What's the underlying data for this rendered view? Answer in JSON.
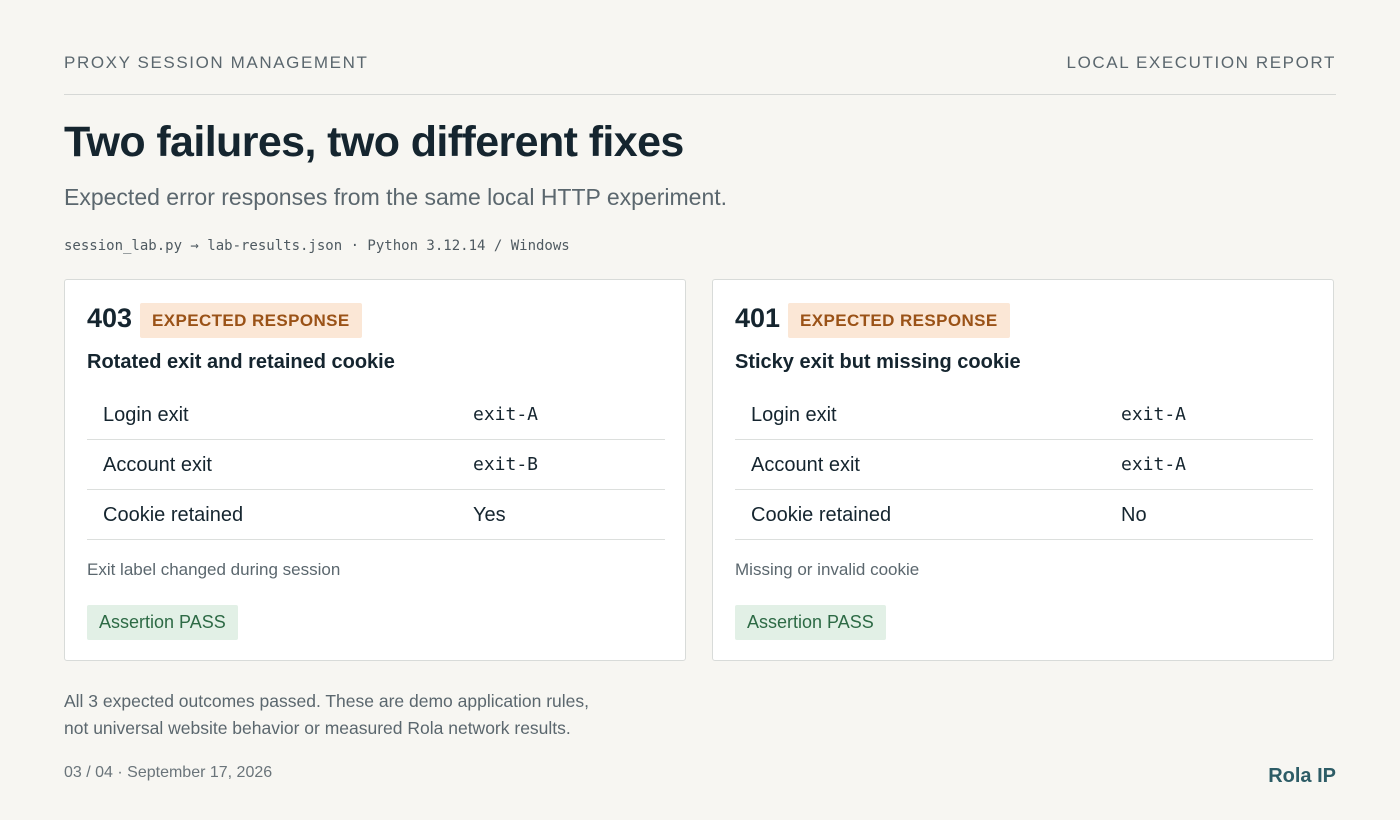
{
  "header": {
    "left_label": "PROXY SESSION MANAGEMENT",
    "right_label": "LOCAL EXECUTION REPORT"
  },
  "title": "Two failures, two different fixes",
  "subtitle": "Expected error responses from the same local HTTP experiment.",
  "meta": "session_lab.py → lab-results.json · Python 3.12.14 / Windows",
  "cards": [
    {
      "code": "403",
      "badge": "EXPECTED RESPONSE",
      "title": "Rotated exit and retained cookie",
      "rows": [
        {
          "label": "Login exit",
          "value": "exit-A"
        },
        {
          "label": "Account exit",
          "value": "exit-B"
        },
        {
          "label": "Cookie retained",
          "value": "Yes"
        }
      ],
      "note": "Exit label changed during session",
      "assertion": "Assertion PASS"
    },
    {
      "code": "401",
      "badge": "EXPECTED RESPONSE",
      "title": "Sticky exit but missing cookie",
      "rows": [
        {
          "label": "Login exit",
          "value": "exit-A"
        },
        {
          "label": "Account exit",
          "value": "exit-A"
        },
        {
          "label": "Cookie retained",
          "value": "No"
        }
      ],
      "note": "Missing or invalid cookie",
      "assertion": "Assertion PASS"
    }
  ],
  "footnote": {
    "line1": "All 3 expected outcomes passed. These are demo application rules,",
    "line2": "not universal website behavior or measured Rola network results."
  },
  "footer": {
    "page_info": "03 / 04 · September 17, 2026",
    "brand": "Rola IP"
  },
  "colors": {
    "background": "#f7f6f2",
    "badge_bg": "#fbe7d6",
    "badge_text": "#9a5217",
    "pass_bg": "#e2f0e6",
    "pass_text": "#2d6a45",
    "brand": "#2d5c66"
  }
}
